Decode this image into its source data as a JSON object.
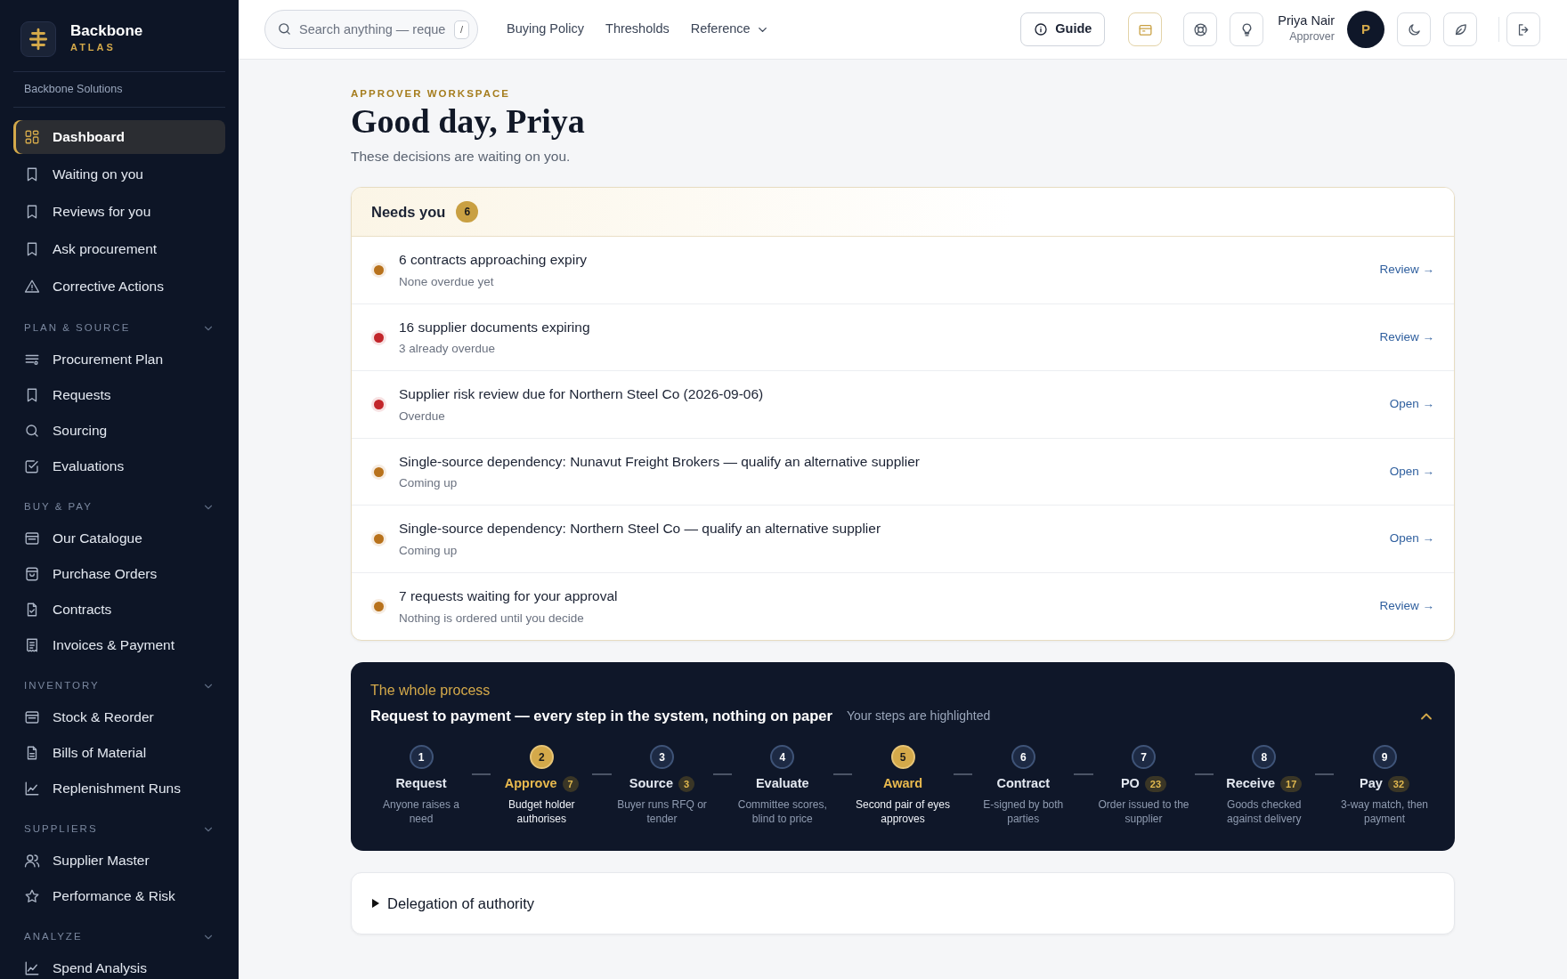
{
  "brand": {
    "name": "Backbone",
    "sub": "ATLAS",
    "org": "Backbone Solutions"
  },
  "sidebar": {
    "items": [
      {
        "label": "Dashboard",
        "selected": true
      },
      {
        "label": "Waiting on you",
        "selected": false
      },
      {
        "label": "Reviews for you",
        "selected": false
      },
      {
        "label": "Ask procurement",
        "selected": false
      },
      {
        "label": "Corrective Actions",
        "selected": false
      }
    ],
    "sections": [
      {
        "title": "PLAN & SOURCE",
        "expanded": true,
        "items": [
          {
            "label": "Procurement Plan",
            "selected": false
          },
          {
            "label": "Requests",
            "selected": false
          },
          {
            "label": "Sourcing",
            "selected": false
          },
          {
            "label": "Evaluations",
            "selected": false
          }
        ]
      },
      {
        "title": "BUY & PAY",
        "expanded": true,
        "items": [
          {
            "label": "Our Catalogue",
            "selected": false
          },
          {
            "label": "Purchase Orders",
            "selected": false
          },
          {
            "label": "Contracts",
            "selected": false
          },
          {
            "label": "Invoices & Payment",
            "selected": false
          }
        ]
      },
      {
        "title": "INVENTORY",
        "expanded": true,
        "items": [
          {
            "label": "Stock & Reorder",
            "selected": false
          },
          {
            "label": "Bills of Material",
            "selected": false
          },
          {
            "label": "Replenishment Runs",
            "selected": false
          }
        ]
      },
      {
        "title": "SUPPLIERS",
        "expanded": true,
        "items": [
          {
            "label": "Supplier Master",
            "selected": false
          },
          {
            "label": "Performance & Risk",
            "selected": false
          }
        ]
      },
      {
        "title": "ANALYZE",
        "expanded": true,
        "items": [
          {
            "label": "Spend Analysis",
            "selected": false
          }
        ]
      }
    ]
  },
  "topbar": {
    "search": {
      "placeholder": "Search anything — reque",
      "shortcut": "/"
    },
    "links": [
      {
        "label": "Buying Policy",
        "dropdown": false
      },
      {
        "label": "Thresholds",
        "dropdown": false
      },
      {
        "label": "Reference",
        "dropdown": true
      }
    ],
    "guide": "Guide",
    "user": {
      "name": "Priya Nair",
      "role": "Approver",
      "initial": "P"
    }
  },
  "header": {
    "eyebrow": "APPROVER WORKSPACE",
    "title": "Good day, Priya",
    "subtitle": "These decisions are waiting on you."
  },
  "needs_you": {
    "title": "Needs you",
    "count": "6",
    "items": [
      {
        "title": "6 contracts approaching expiry",
        "detail": "None overdue yet",
        "action": "Review →",
        "color": "#b8721c"
      },
      {
        "title": "16 supplier documents expiring",
        "detail": "3 already overdue",
        "action": "Review →",
        "color": "#c2262b"
      },
      {
        "title": "Supplier risk review due for Northern Steel Co (2026-09-06)",
        "detail": "Overdue",
        "action": "Open →",
        "color": "#c2262b"
      },
      {
        "title": "Single-source dependency: Nunavut Freight Brokers — qualify an alternative supplier",
        "detail": "Coming up",
        "action": "Open →",
        "color": "#b8721c"
      },
      {
        "title": "Single-source dependency: Northern Steel Co — qualify an alternative supplier",
        "detail": "Coming up",
        "action": "Open →",
        "color": "#b8721c"
      },
      {
        "title": "7 requests waiting for your approval",
        "detail": "Nothing is ordered until you decide",
        "action": "Review →",
        "color": "#b8721c"
      }
    ]
  },
  "process": {
    "eyebrow": "The whole process",
    "title": "Request to payment — every step in the system, nothing on paper",
    "hint": "Your steps are highlighted",
    "expanded": true,
    "steps": [
      {
        "number": "1",
        "label": "Request",
        "description": "Anyone raises a need",
        "highlighted": false
      },
      {
        "number": "2",
        "label": "Approve",
        "count": "7",
        "description": "Budget holder authorises",
        "highlighted": true
      },
      {
        "number": "3",
        "label": "Source",
        "count": "3",
        "description": "Buyer runs RFQ or tender",
        "highlighted": false
      },
      {
        "number": "4",
        "label": "Evaluate",
        "description": "Committee scores, blind to price",
        "highlighted": false
      },
      {
        "number": "5",
        "label": "Award",
        "description": "Second pair of eyes approves",
        "highlighted": true
      },
      {
        "number": "6",
        "label": "Contract",
        "description": "E-signed by both parties",
        "highlighted": false
      },
      {
        "number": "7",
        "label": "PO",
        "count": "23",
        "description": "Order issued to the supplier",
        "highlighted": false
      },
      {
        "number": "8",
        "label": "Receive",
        "count": "17",
        "description": "Goods checked against delivery",
        "highlighted": false
      },
      {
        "number": "9",
        "label": "Pay",
        "count": "32",
        "description": "3-way match, then payment",
        "highlighted": false
      }
    ]
  },
  "delegation": {
    "title": "Delegation of authority",
    "expanded": false
  }
}
